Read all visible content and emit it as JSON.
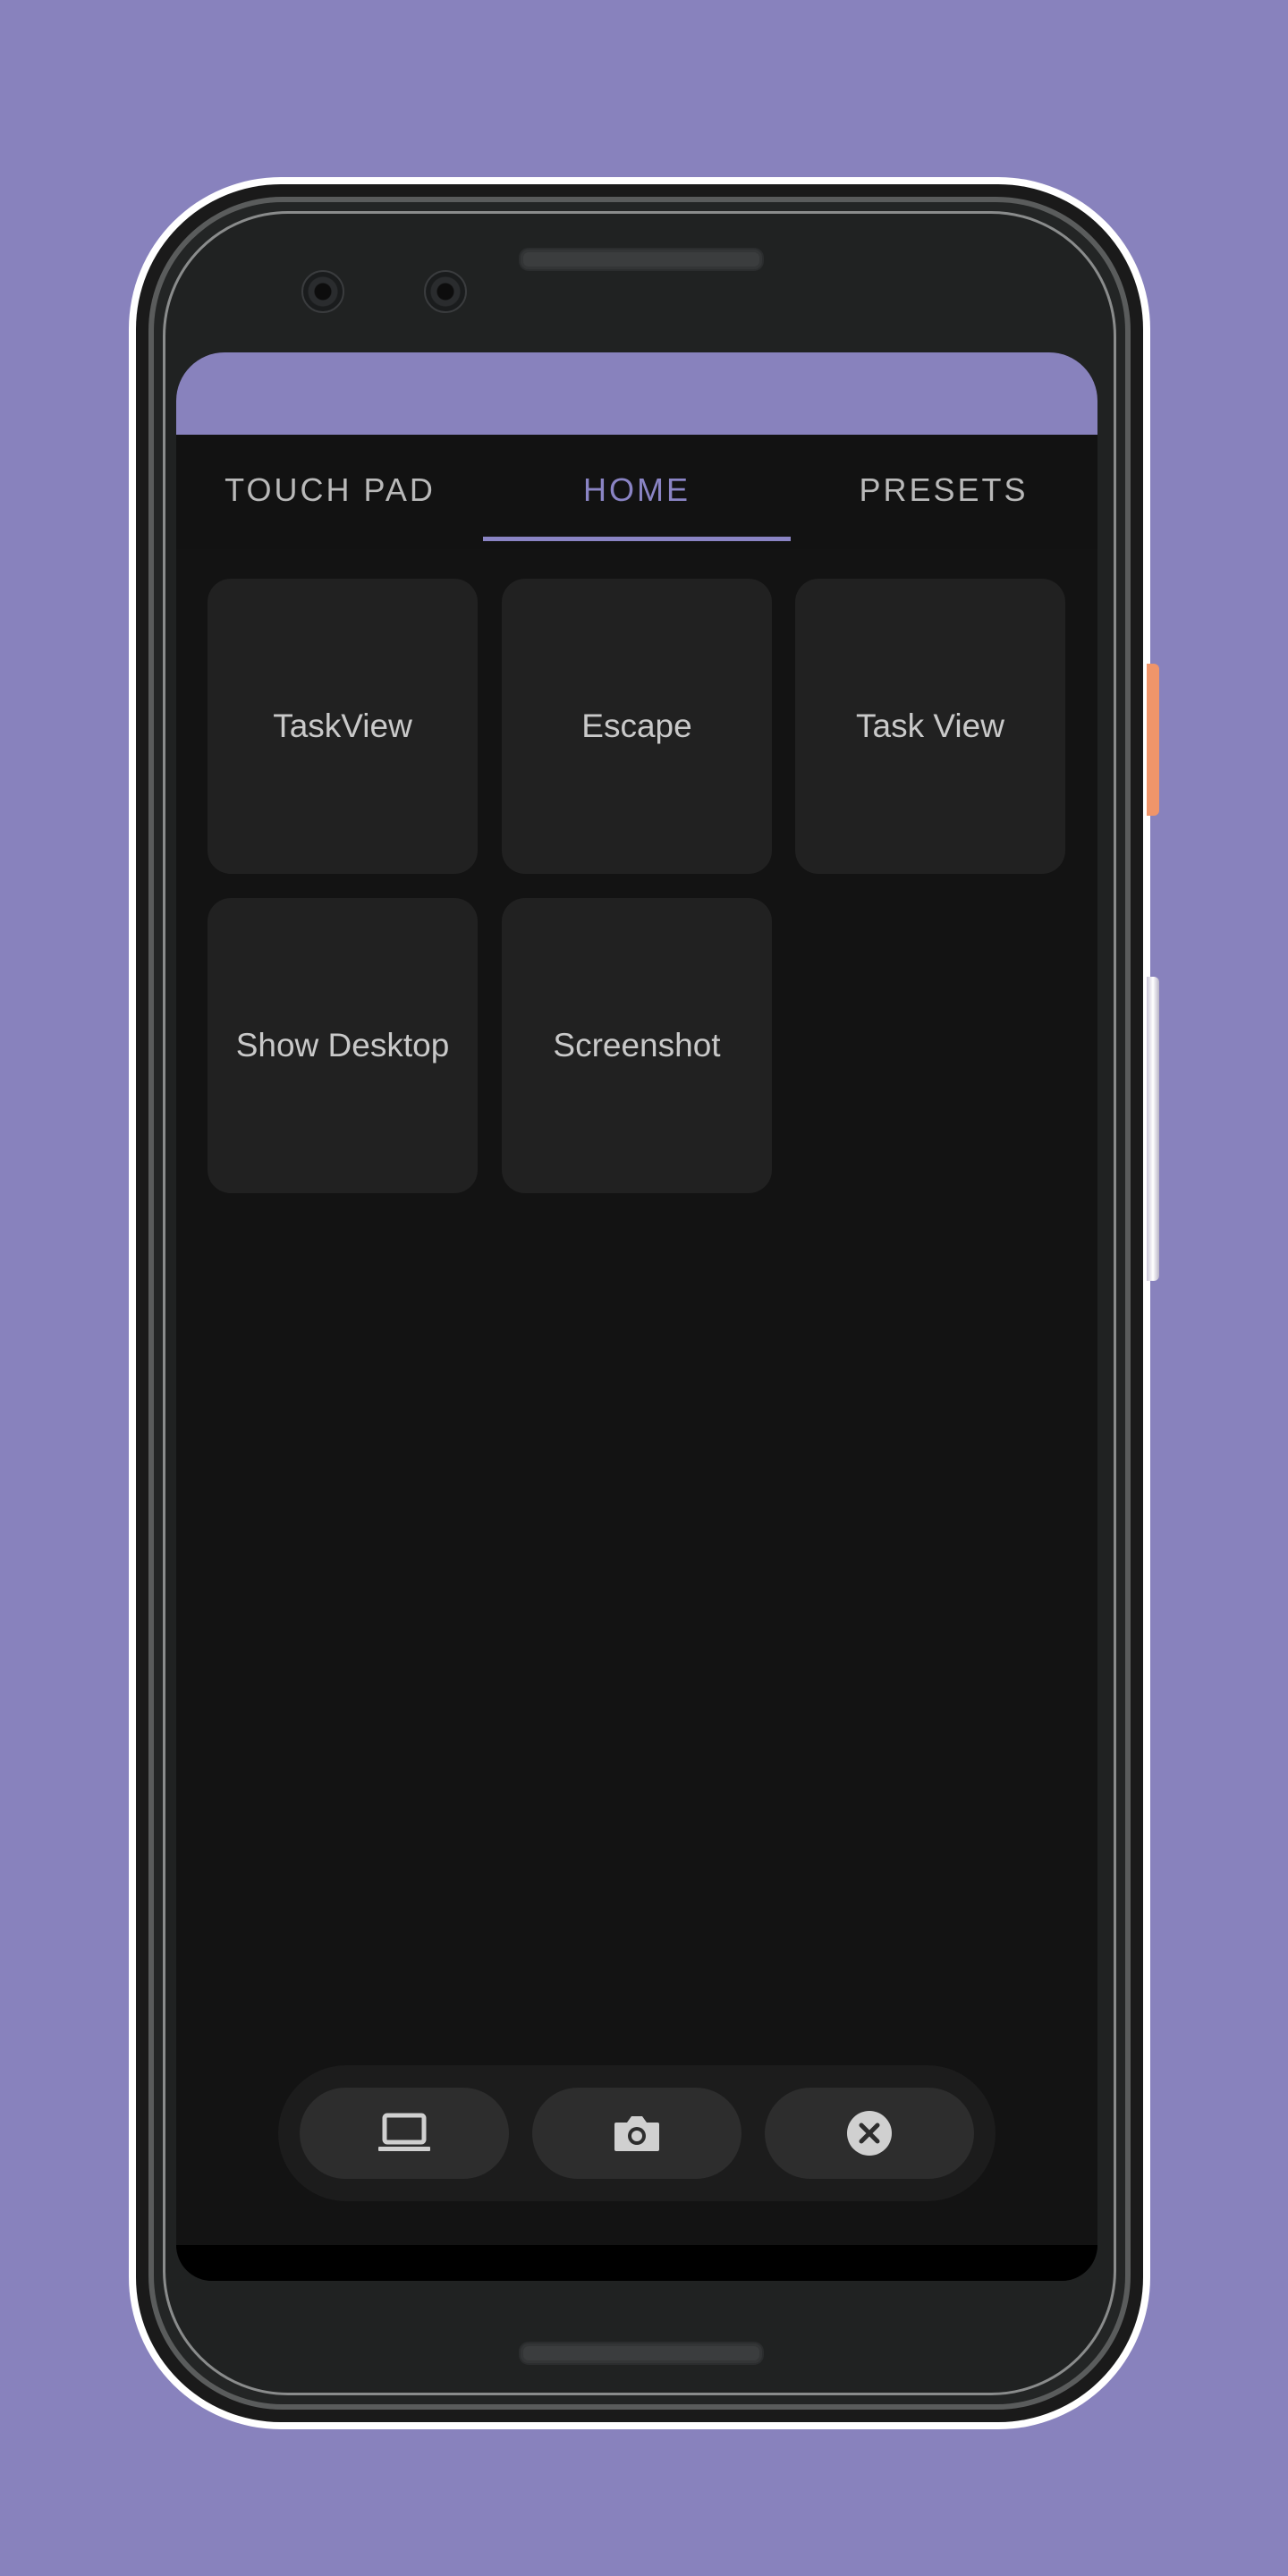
{
  "tabs": [
    {
      "label": "TOUCH PAD",
      "active": false
    },
    {
      "label": "HOME",
      "active": true
    },
    {
      "label": "PRESETS",
      "active": false
    }
  ],
  "shortcuts": [
    {
      "label": "TaskView"
    },
    {
      "label": "Escape"
    },
    {
      "label": "Task View"
    },
    {
      "label": "Show Desktop"
    },
    {
      "label": "Screenshot"
    }
  ],
  "toolbar": {
    "buttons": [
      {
        "icon": "laptop-icon"
      },
      {
        "icon": "camera-icon"
      },
      {
        "icon": "close-circle-icon"
      }
    ]
  },
  "colors": {
    "accent": "#8a84c4",
    "background": "#8882bd",
    "screen": "#131313",
    "card": "#212121"
  }
}
